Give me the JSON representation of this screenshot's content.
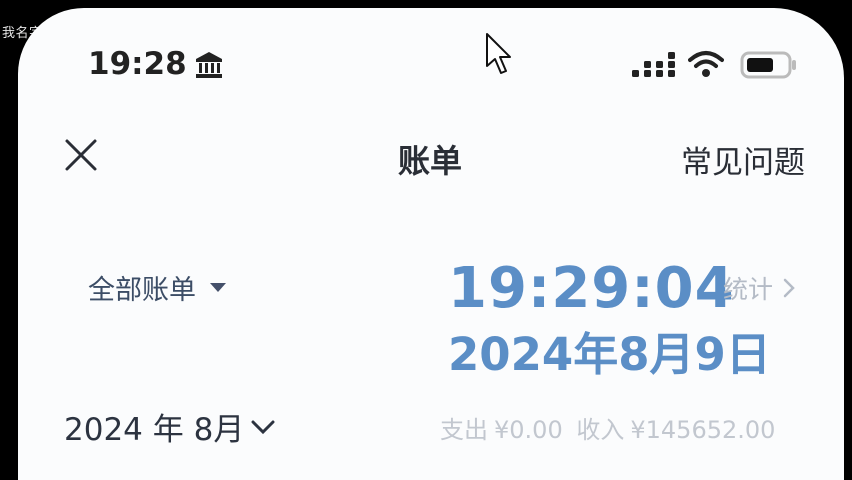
{
  "overlay": {
    "text": "我名字"
  },
  "status_bar": {
    "time": "19:28",
    "icons": [
      "bank-icon",
      "signal-icon",
      "wifi-icon",
      "battery-icon"
    ]
  },
  "nav": {
    "close_icon": "close-icon",
    "title": "账单",
    "faq": "常见问题"
  },
  "filter": {
    "label": "全部账单",
    "stats": "统计"
  },
  "clock": {
    "time": "19:29:04",
    "date": "2024年8月9日"
  },
  "month": {
    "label": "2024 年 8月"
  },
  "summary": {
    "expense_label": "支出",
    "expense_value": "¥0.00",
    "income_label": "收入",
    "income_value": "¥145652.00"
  },
  "colors": {
    "accent": "#5b8ec6",
    "text_dark": "#2a2e36",
    "muted": "#c2c7cf",
    "background": "#fbfcfd"
  }
}
